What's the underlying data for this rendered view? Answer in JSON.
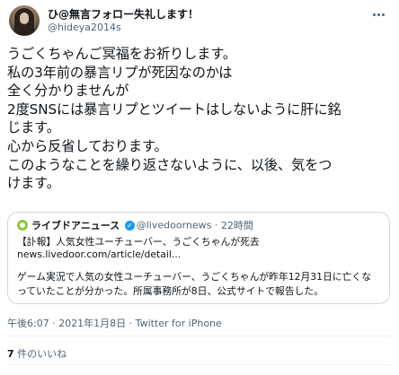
{
  "author": {
    "display_name": "ひ@無言フォロー失礼します！",
    "handle": "@hideya2014s"
  },
  "tweet": {
    "lines": [
      "うごくちゃんご冥福をお祈りします。",
      "私の3年前の暴言リプが死因なのかは",
      "全く分かりませんが",
      "2度SNSには暴言リプとツイートはしないように肝に銘",
      "じます。",
      "心から反省しております。",
      "このようなことを繰り返さないように、以後、気をつ",
      "けます。"
    ]
  },
  "quote": {
    "name": "ライブドアニュース",
    "handle": "@livedoornews",
    "time": "22時間",
    "headline": "【訃報】人気女性ユーチューバー、うごくちゃんが死去",
    "link": "news.livedoor.com/article/detail...",
    "body_lines": [
      "ゲーム実況で人気の女性ユーチューバー、うごくちゃんが昨年12月31日に亡くな",
      "っていたことが分かった。所属事務所が8日、公式サイトで報告した。"
    ],
    "brand_color": "#8cc63f"
  },
  "meta": {
    "timestamp": "午後6:07 · 2021年1月8日 · Twitter for iPhone"
  },
  "stats": {
    "likes_count": "7",
    "likes_label": "件のいいね"
  },
  "colors": {
    "text": "#0f1419",
    "secondary": "#536471",
    "border": "#cfd9de",
    "verified": "#1d9bf0"
  }
}
